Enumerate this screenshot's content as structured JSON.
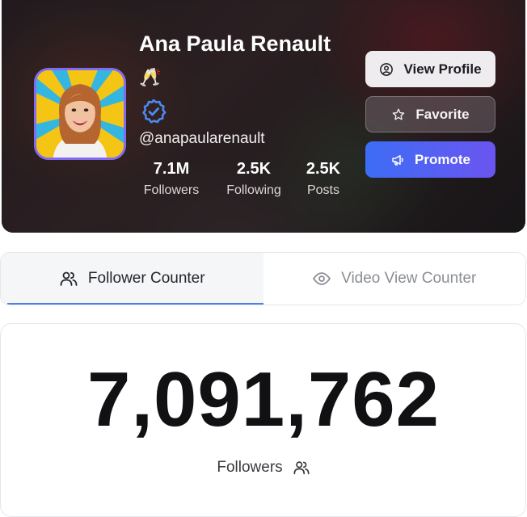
{
  "profile": {
    "name": "Ana Paula Renault",
    "name_emoji": "🥂",
    "handle": "@anapaularenault",
    "verified": true,
    "accent_color": "#7f6cf0",
    "stats": [
      {
        "value": "7.1M",
        "label": "Followers"
      },
      {
        "value": "2.5K",
        "label": "Following"
      },
      {
        "value": "2.5K",
        "label": "Posts"
      }
    ]
  },
  "actions": {
    "view_profile": {
      "label": "View Profile",
      "icon": "user-circle-icon"
    },
    "favorite": {
      "label": "Favorite",
      "icon": "star-icon"
    },
    "promote": {
      "label": "Promote",
      "icon": "megaphone-icon",
      "color_start": "#3d6df5",
      "color_end": "#6a55f0"
    }
  },
  "tabs": [
    {
      "label": "Follower Counter",
      "icon": "users-icon",
      "active": true
    },
    {
      "label": "Video View Counter",
      "icon": "eye-icon",
      "active": false
    }
  ],
  "counter": {
    "value": "7,091,762",
    "label": "Followers",
    "icon": "users-icon"
  }
}
